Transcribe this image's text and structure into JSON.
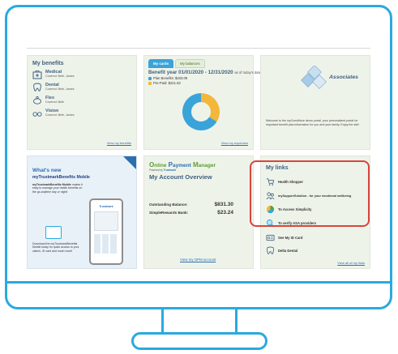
{
  "colors": {
    "accent": "#2aa9e0",
    "title": "#3f5f7f",
    "highlight": "#d9443a",
    "donut_blue": "#3aa3d9",
    "donut_orange": "#f3b73c"
  },
  "benefits": {
    "title": "My benefits",
    "items": [
      {
        "name": "Medical",
        "covered": "Covered: Beth, James",
        "icon": "medical-kit-icon"
      },
      {
        "name": "Dental",
        "covered": "Covered: Beth, James",
        "icon": "tooth-icon"
      },
      {
        "name": "Flex",
        "covered": "Covered: Beth",
        "icon": "piggy-bank-icon"
      },
      {
        "name": "Vision",
        "covered": "Covered: Beth, James",
        "icon": "glasses-icon"
      }
    ],
    "link": "View my benefits"
  },
  "cards": {
    "tabs": [
      "My cards",
      "My balances"
    ],
    "plan_year": "Benefit year 01/01/2020 - 12/31/2020",
    "plan_year_suffix": "as of today's date",
    "plan_benefits_label": "Plan Benefits: $433.09",
    "ytd_label": "Pre-Paid: $221.53",
    "plan_benefits_value": 433.09,
    "ytd_value": 221.53,
    "link": "View my expenses"
  },
  "associates": {
    "logo_text": "Associates",
    "text": "Welcome to the myConsillvice demo portal, your personalized portal for important benefit plan information for you and your family. Enjoy the site!"
  },
  "promo": {
    "title": "What's new",
    "subtitle": "myTrustmarkBenefits Mobile",
    "p1_bold": "myTrustmarkBenefits Mobile",
    "p1": "makes it easy to manage your health benefits on the go-anytime day or night!",
    "p2": "Download the myTrustmarkBenefits Mobile today for quick access to your claims, ID card and much more!",
    "phone_brand": "Trustmark"
  },
  "opm": {
    "logo_o": "O",
    "logo_nline": "nline",
    "logo_p": "P",
    "logo_ayment": "ayment",
    "logo_m": "M",
    "logo_anager": "anager",
    "powered": "Powered by ",
    "powered_brand": "Trustmark",
    "title": "My Account Overview",
    "rows": [
      {
        "label": "Outstanding Balance:",
        "value": "$831.30"
      },
      {
        "label": "SimpleRewards Bank:",
        "value": "$23.24"
      }
    ],
    "link": "View my OPM account"
  },
  "mylinks": {
    "title": "My links",
    "items": [
      {
        "label": "Health Shopper",
        "icon": "shopping-cart-icon"
      },
      {
        "label": "mySupportSolution - for your emotional wellbeing",
        "icon": "people-icon"
      },
      {
        "label": "To Access Simplicity",
        "icon": "simplicity-logo-icon"
      },
      {
        "label": "To verify ASA providers",
        "icon": "magnifier-icon"
      },
      {
        "label": "See My ID Card",
        "icon": "id-card-icon"
      },
      {
        "label": "Delta Dental",
        "icon": "tooth-icon"
      }
    ],
    "link": "View all of my links"
  }
}
